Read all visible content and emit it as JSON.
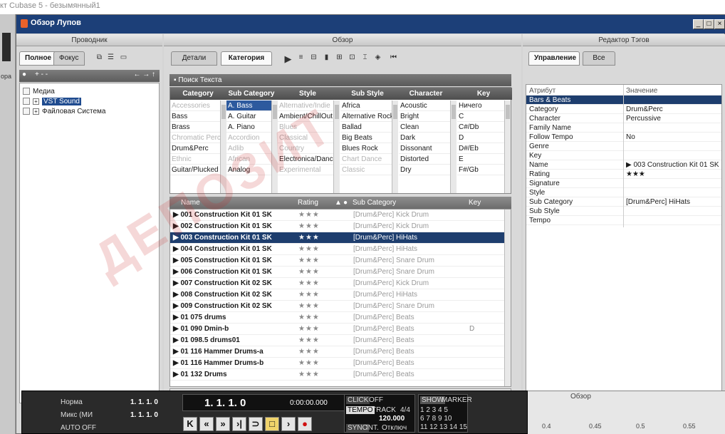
{
  "host": {
    "title": "кт Cubase 5 - безымянный1",
    "side_label": "opa"
  },
  "window": {
    "title": "Обзор Лупов",
    "controls": [
      "_",
      "□",
      "×"
    ]
  },
  "browser": {
    "title": "Проводник",
    "tabs": [
      "Полное",
      "Фокус"
    ],
    "toolbar_left": "+ - -",
    "toolbar_right": "← → ↑",
    "tree": [
      {
        "label": "Медиа",
        "expanded": true
      },
      {
        "label": "VST Sound",
        "selected": true
      },
      {
        "label": "Файловая Система"
      }
    ]
  },
  "overview": {
    "title": "Обзор",
    "tabs": [
      "Детали",
      "Категория"
    ],
    "search_label": "Поиск Текста",
    "filter_headers": [
      "Category",
      "Sub Category",
      "Style",
      "Sub Style",
      "Character",
      "Key"
    ],
    "filter_columns": [
      [
        "Accessories",
        "Bass",
        "Brass",
        "Chromatic Perc",
        "Drum&Perc",
        "Ethnic",
        "Guitar/Plucked"
      ],
      [
        "A. Bass",
        "A. Guitar",
        "A. Piano",
        "Accordion",
        "Adlib",
        "African",
        "Analog"
      ],
      [
        "Alternative/Indie",
        "Ambient/ChillOut",
        "Blues",
        "Classical",
        "Country",
        "Electronica/Dance",
        "Experimental"
      ],
      [
        "Africa",
        "Alternative Rock",
        "Ballad",
        "Big Beats",
        "Blues Rock",
        "Chart Dance",
        "Classic"
      ],
      [
        "Acoustic",
        "Bright",
        "Clean",
        "Dark",
        "Dissonant",
        "Distorted",
        "Dry"
      ],
      [
        "Ничего",
        "C",
        "C#/Db",
        "D",
        "D#/Eb",
        "E",
        "F#/Gb"
      ]
    ],
    "result_headers": {
      "name": "Name",
      "rating": "Rating",
      "subcat": "Sub Category",
      "key": "Key"
    },
    "results": [
      {
        "name": "001 Construction Kit 01 SK",
        "rating": "★★★",
        "subcat": "[Drum&Perc] Kick Drum",
        "key": ""
      },
      {
        "name": "002 Construction Kit 01 SK",
        "rating": "★★★",
        "subcat": "[Drum&Perc] Kick Drum",
        "key": ""
      },
      {
        "name": "003 Construction Kit 01 SK",
        "rating": "★★★",
        "subcat": "[Drum&Perc] HiHats",
        "key": "",
        "selected": true
      },
      {
        "name": "004 Construction Kit 01 SK",
        "rating": "★★★",
        "subcat": "[Drum&Perc] HiHats",
        "key": ""
      },
      {
        "name": "005 Construction Kit 01 SK",
        "rating": "★★★",
        "subcat": "[Drum&Perc] Snare Drum",
        "key": ""
      },
      {
        "name": "006 Construction Kit 01 SK",
        "rating": "★★★",
        "subcat": "[Drum&Perc] Snare Drum",
        "key": ""
      },
      {
        "name": "007 Construction Kit 02 SK",
        "rating": "★★★",
        "subcat": "[Drum&Perc] Kick Drum",
        "key": ""
      },
      {
        "name": "008 Construction Kit 02 SK",
        "rating": "★★★",
        "subcat": "[Drum&Perc] HiHats",
        "key": ""
      },
      {
        "name": "009 Construction Kit 02 SK",
        "rating": "★★★",
        "subcat": "[Drum&Perc] Snare Drum",
        "key": ""
      },
      {
        "name": "01 075 drums",
        "rating": "★★★",
        "subcat": "[Drum&Perc] Beats",
        "key": ""
      },
      {
        "name": "01 090 Dmin-b",
        "rating": "★★★",
        "subcat": "[Drum&Perc] Beats",
        "key": "D"
      },
      {
        "name": "01 098.5 drums01",
        "rating": "★★★",
        "subcat": "[Drum&Perc] Beats",
        "key": ""
      },
      {
        "name": "01 116 Hammer Drums-a",
        "rating": "★★★",
        "subcat": "[Drum&Perc] Beats",
        "key": ""
      },
      {
        "name": "01 116 Hammer Drums-b",
        "rating": "★★★",
        "subcat": "[Drum&Perc] Beats",
        "key": ""
      },
      {
        "name": "01 132 Drums",
        "rating": "★★★",
        "subcat": "[Drum&Perc] Beats",
        "key": ""
      }
    ]
  },
  "tags": {
    "title": "Редактор Тэгов",
    "tabs": [
      "Управление",
      "Все"
    ],
    "headers": {
      "attr": "Атрибут",
      "value": "Значение"
    },
    "rows": [
      {
        "attr": "Bars & Beats",
        "value": "",
        "selected": true
      },
      {
        "attr": "Category",
        "value": "Drum&Perc"
      },
      {
        "attr": "Character",
        "value": "Percussive"
      },
      {
        "attr": "Family Name",
        "value": ""
      },
      {
        "attr": "Follow Tempo",
        "value": "No"
      },
      {
        "attr": "Genre",
        "value": ""
      },
      {
        "attr": "Key",
        "value": ""
      },
      {
        "attr": "Name",
        "value": "▶ 003 Construction Kit 01 SK"
      },
      {
        "attr": "Rating",
        "value": "★★★"
      },
      {
        "attr": "Signature",
        "value": ""
      },
      {
        "attr": "Style",
        "value": ""
      },
      {
        "attr": "Sub Category",
        "value": "[Drum&Perc] HiHats"
      },
      {
        "attr": "Sub Style",
        "value": ""
      },
      {
        "attr": "Tempo",
        "value": ""
      }
    ]
  },
  "transport": {
    "norm": "Норма",
    "mix": "Микс (МИ",
    "auto": "AUTO",
    "off": "OFF",
    "pos_left": "1. 1. 1. 0",
    "pos_right": "1. 1. 1. 0",
    "pos_main": "1. 1. 1. 0",
    "time": "0:00:00.000",
    "click_label": "CLICK",
    "click_value": "OFF",
    "tempo_label": "TEMPO",
    "tempo_mode": "TRACK",
    "signature": "4/4",
    "tempo_value": "120.000",
    "sync_label": "SYNC",
    "sync_value": "INT.",
    "sync_state": "Отключ",
    "show_label": "SHOW",
    "marker_label": "MARKER",
    "markers": [
      "1 2 3 4 5",
      "6 7 8 9 10",
      "11 12 13 14 15"
    ]
  },
  "bottom_panel": {
    "label": "Обзор",
    "ruler": [
      "0.4",
      "0.45",
      "0.5",
      "0.55"
    ]
  },
  "watermark": "ДЕПОЗИТ"
}
